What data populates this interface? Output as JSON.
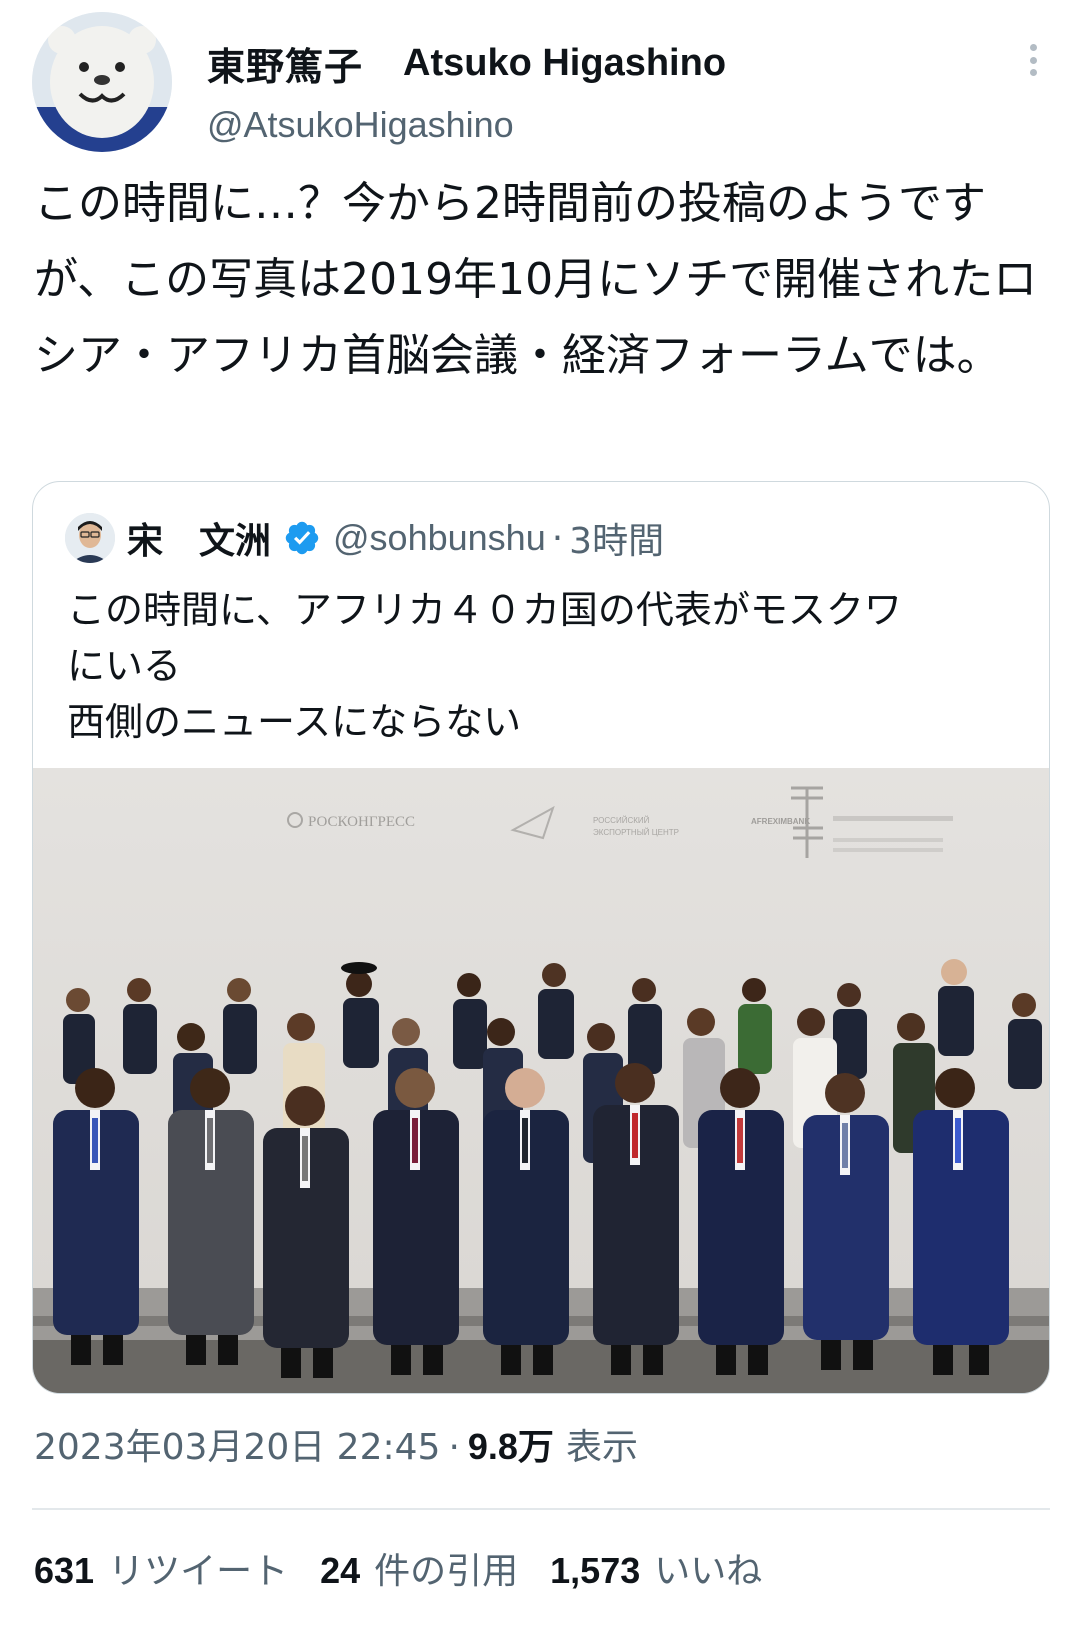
{
  "author": {
    "display_name": "東野篤子",
    "display_name_en": "Atsuko Higashino",
    "handle": "@AtsukoHigashino",
    "avatar_icon": "bear-mascot-avatar-icon"
  },
  "tweet": {
    "text": "この時間に…？今から2時間前の投稿のようですが、この写真は2019年10月にソチで開催されたロシア・アフリカ首脳会議・経済フォーラムでは。"
  },
  "quoted": {
    "display_name": "宋　文洲",
    "handle": "@sohbunshu",
    "separator": "·",
    "time": "3時間",
    "text": "この時間に、アフリカ４０カ国の代表がモスクワ\nにいる\n西側のニュースにならない",
    "photo_texts": {
      "logo_1": "РОСКОНГРЕСС",
      "logo_2_line1": "РОССИЙСКИЙ",
      "logo_2_line2": "ЭКСПОРТНЫЙ ЦЕНТР",
      "logo_3": "AFREXIMBANK"
    }
  },
  "meta": {
    "timestamp": "2023年03月20日 22:45",
    "separator": "·",
    "views_count": "9.8万",
    "views_label": "表示"
  },
  "stats": {
    "retweets_count": "631",
    "retweets_label": "リツイート",
    "quotes_count": "24",
    "quotes_label": "件の引用",
    "likes_count": "1,573",
    "likes_label": "いいね"
  },
  "colors": {
    "text_primary": "#0f1419",
    "text_secondary": "#536471",
    "verified_blue": "#1d9bf0",
    "border": "#cfd9de"
  }
}
